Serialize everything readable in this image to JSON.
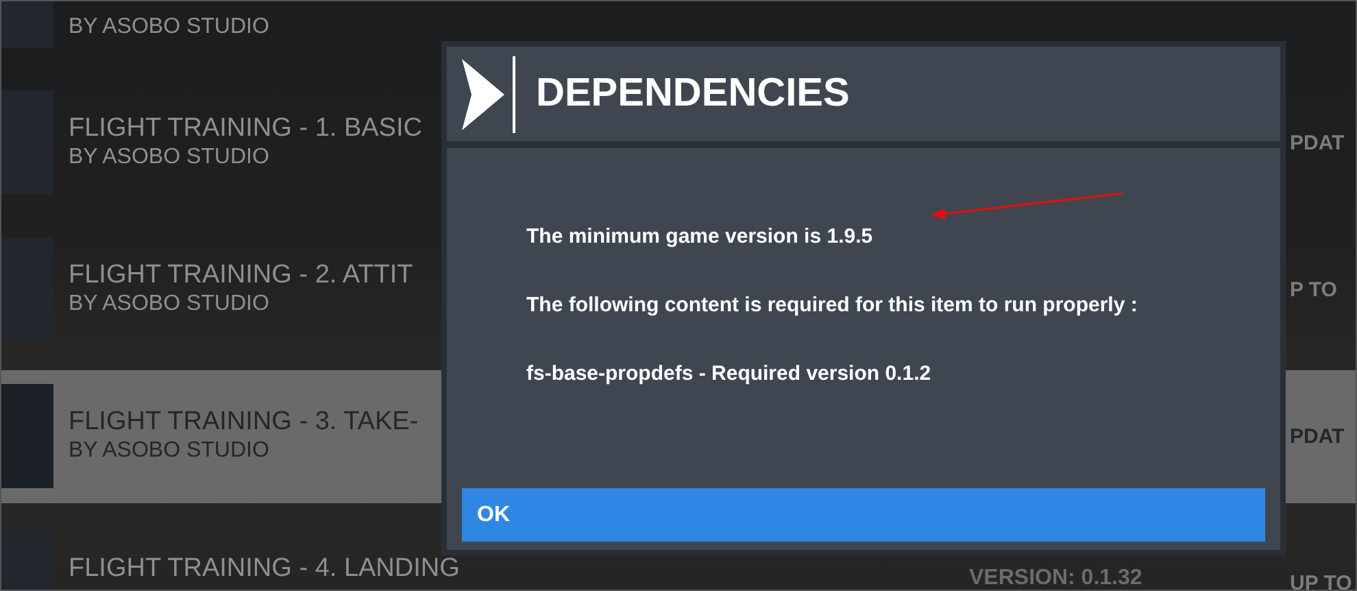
{
  "content_list": [
    {
      "author": "BY ASOBO STUDIO",
      "selected": false
    },
    {
      "title": "FLIGHT TRAINING - 1. BASIC",
      "author": "BY ASOBO STUDIO",
      "status": "PDAT",
      "selected": false
    },
    {
      "title": "FLIGHT TRAINING - 2. ATTIT",
      "author": "BY ASOBO STUDIO",
      "status": "P TO",
      "selected": false
    },
    {
      "title": "FLIGHT TRAINING - 3. TAKE-",
      "author": "BY ASOBO STUDIO",
      "status": "PDAT",
      "selected": true
    },
    {
      "title": "FLIGHT TRAINING - 4. LANDING",
      "version": "VERSION: 0.1.32",
      "status": "UP TO",
      "selected": false
    }
  ],
  "dialog": {
    "title": "DEPENDENCIES",
    "messages": [
      "The minimum game version is 1.9.5",
      "The following content is required for this item to run properly :",
      "fs-base-propdefs - Required version 0.1.2"
    ],
    "button": "OK"
  }
}
